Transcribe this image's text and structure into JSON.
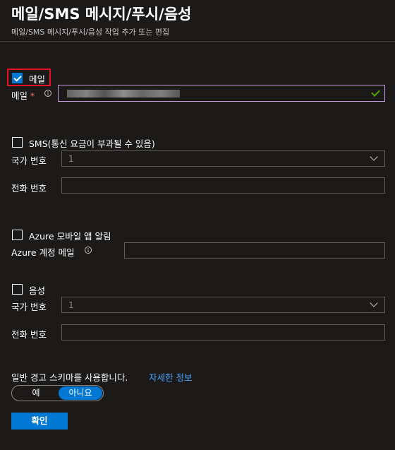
{
  "header": {
    "title": "메일/SMS 메시지/푸시/음성",
    "subtitle": "메일/SMS 메시지/푸시/음성 작업 추가 또는 편집"
  },
  "email": {
    "checkbox_label": "메일",
    "checked": true,
    "field_label": "메일",
    "required_marker": "*",
    "info_glyph": "i"
  },
  "sms": {
    "checkbox_label": "SMS(통신 요금이 부과될 수 있음)",
    "checked": false,
    "country_label": "국가 번호",
    "country_value": "1",
    "phone_label": "전화 번호",
    "phone_value": ""
  },
  "push": {
    "checkbox_label": "Azure 모바일 앱 알림",
    "checked": false,
    "account_label": "Azure 계정 메일",
    "info_glyph": "i",
    "account_value": ""
  },
  "voice": {
    "checkbox_label": "음성",
    "checked": false,
    "country_label": "국가 번호",
    "country_value": "1",
    "phone_label": "전화 번호",
    "phone_value": ""
  },
  "schema": {
    "question": "일반 경고 스키마를 사용합니다.",
    "learn_more": "자세한 정보",
    "options": [
      "예",
      "아니요"
    ],
    "selected": "아니요"
  },
  "footer": {
    "ok_label": "확인"
  },
  "colors": {
    "accent": "#0078d4",
    "highlight_box": "#e81123",
    "valid_check": "#57a300",
    "focus_border": "#c19ee0"
  }
}
